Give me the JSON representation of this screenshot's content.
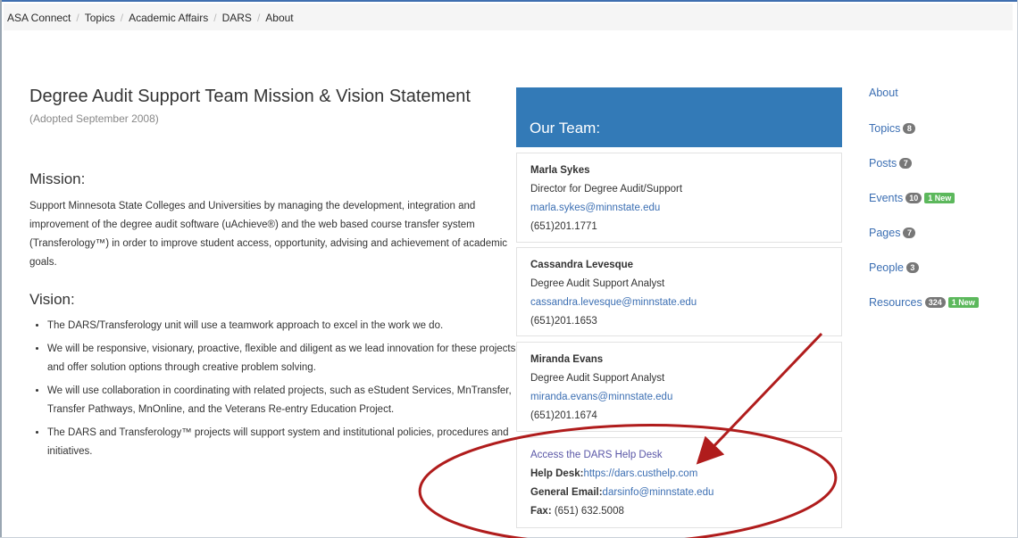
{
  "breadcrumb": [
    "ASA Connect",
    "Topics",
    "Academic Affairs",
    "DARS",
    "About"
  ],
  "page": {
    "title": "Degree Audit Support Team Mission & Vision Statement",
    "adopted": "(Adopted September 2008)",
    "mission_heading": "Mission:",
    "mission_text": "Support Minnesota State Colleges and Universities by managing the development, integration and improvement of the degree audit software (uAchieve®) and the web based course transfer system (Transferology™) in order to improve student access, opportunity, advising and achievement of academic goals.",
    "vision_heading": "Vision:",
    "vision_items": [
      "The DARS/Transferology unit will use a teamwork approach to excel in the work we do.",
      "We will be responsive, visionary, proactive, flexible and diligent as we lead innovation for these projects and offer solution options through creative problem solving.",
      "We will use collaboration in coordinating with related projects, such as eStudent Services, MnTransfer, Transfer Pathways, MnOnline, and the Veterans Re-entry Education Project.",
      "The DARS and Transferology™ projects will support system and institutional policies, procedures and initiatives."
    ]
  },
  "team": {
    "heading": "Our Team:",
    "members": [
      {
        "name": "Marla Sykes",
        "title": "Director for Degree Audit/Support",
        "email": "marla.sykes@minnstate.edu",
        "phone": "(651)201.1771"
      },
      {
        "name": "Cassandra Levesque",
        "title": "Degree Audit Support Analyst",
        "email": "cassandra.levesque@minnstate.edu",
        "phone": "(651)201.1653"
      },
      {
        "name": "Miranda Evans",
        "title": "Degree Audit Support Analyst",
        "email": "miranda.evans@minnstate.edu",
        "phone": "(651)201.1674"
      }
    ],
    "help": {
      "link": "Access the DARS Help Desk",
      "desk_label": "Help Desk:",
      "desk_url": "https://dars.custhelp.com",
      "email_label": "General Email:",
      "email": "darsinfo@minnstate.edu",
      "fax_label": "Fax:",
      "fax": " (651) 632.5008"
    }
  },
  "sidebar": {
    "about": "About",
    "topics": {
      "label": "Topics",
      "count": "8"
    },
    "posts": {
      "label": "Posts",
      "count": "7"
    },
    "events": {
      "label": "Events",
      "count": "10",
      "new": "1 New"
    },
    "pages": {
      "label": "Pages",
      "count": "7"
    },
    "people": {
      "label": "People",
      "count": "3"
    },
    "resources": {
      "label": "Resources",
      "count": "324",
      "new": "1 New"
    }
  },
  "annotation": {
    "color": "#b01c1c"
  }
}
